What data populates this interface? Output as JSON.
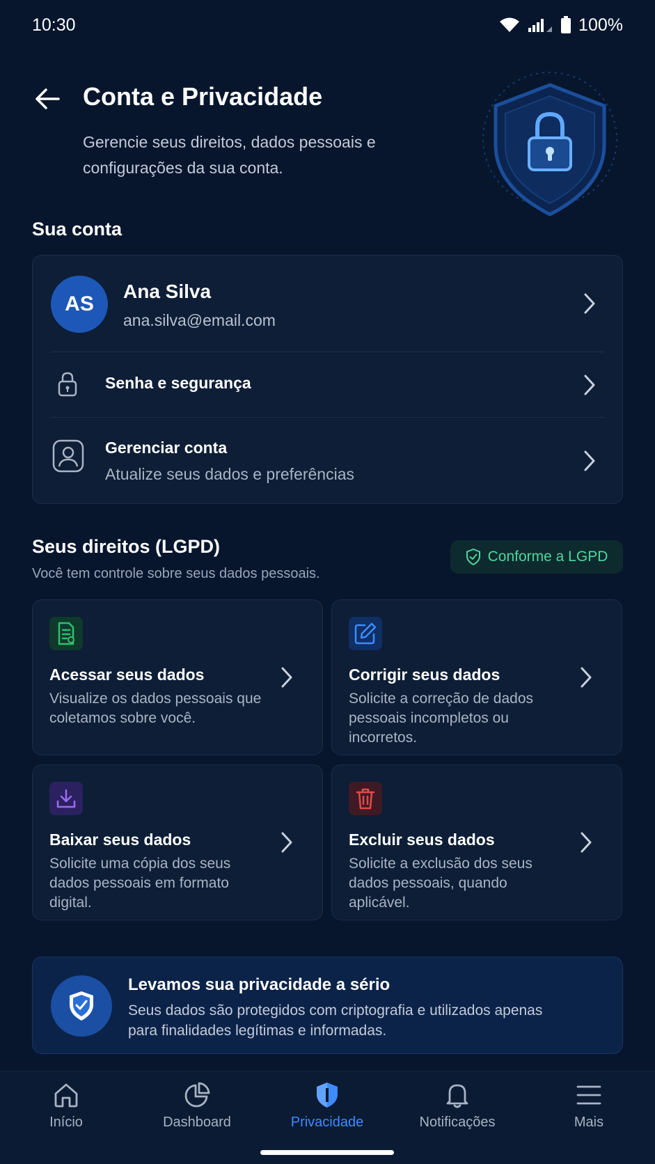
{
  "status_bar": {
    "time": "10:30",
    "battery": "100%"
  },
  "header": {
    "title": "Conta e Privacidade",
    "subtitle": "Gerencie seus direitos, dados pessoais e configurações da sua conta."
  },
  "account_section": {
    "title": "Sua conta",
    "profile": {
      "initials": "AS",
      "name": "Ana Silva",
      "email": "ana.silva@email.com"
    },
    "security": {
      "label": "Senha e segurança"
    },
    "manage": {
      "label": "Gerenciar conta",
      "sub": "Atualize seus dados e preferências"
    }
  },
  "rights_section": {
    "title": "Seus direitos (LGPD)",
    "desc": "Você tem controle sobre seus dados pessoais.",
    "badge": "Conforme a LGPD",
    "cards": [
      {
        "title": "Acessar seus dados",
        "desc": "Visualize os dados pessoais que coletamos sobre você.",
        "icon": "document-icon",
        "color": "#2fbf71"
      },
      {
        "title": "Corrigir seus dados",
        "desc": "Solicite a correção de dados pessoais incompletos ou incorretos.",
        "icon": "edit-icon",
        "color": "#3d8bfd"
      },
      {
        "title": "Baixar seus dados",
        "desc": "Solicite uma cópia dos seus dados pessoais em formato digital.",
        "icon": "download-icon",
        "color": "#9b6cf0"
      },
      {
        "title": "Excluir seus dados",
        "desc": "Solicite a exclusão dos seus dados pessoais, quando aplicável.",
        "icon": "trash-icon",
        "color": "#e5484d"
      }
    ]
  },
  "info": {
    "title": "Levamos sua privacidade a sério",
    "text": "Seus dados são protegidos com criptografia e utilizados apenas para finalidades legítimas e informadas."
  },
  "nav": {
    "items": [
      {
        "label": "Início",
        "icon": "home-icon"
      },
      {
        "label": "Dashboard",
        "icon": "pie-chart-icon"
      },
      {
        "label": "Privacidade",
        "icon": "shield-icon",
        "active": true
      },
      {
        "label": "Notificações",
        "icon": "bell-icon"
      },
      {
        "label": "Mais",
        "icon": "menu-icon"
      }
    ],
    "active_color": "#3d8bfd"
  }
}
